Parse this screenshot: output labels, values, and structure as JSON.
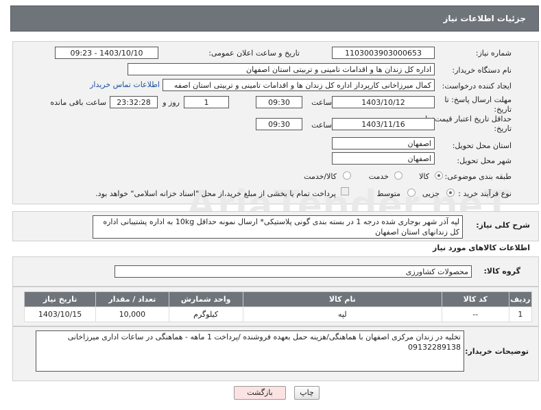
{
  "header": {
    "title": "جزئیات اطلاعات نیاز"
  },
  "form": {
    "need_number_label": "شماره نیاز:",
    "need_number": "1103003903000653",
    "announce_label": "تاریخ و ساعت اعلان عمومی:",
    "announce_value": "1403/10/10 - 09:23",
    "buyer_org_label": "نام دستگاه خریدار:",
    "buyer_org": "اداره کل زندان ها و اقدامات تامینی و تربیتی استان اصفهان",
    "creator_label": "ایجاد کننده درخواست:",
    "creator": "کمال میرزاخانی کارپرداز اداره کل زندان ها و اقدامات تامینی و تربیتی استان اصفه",
    "contact_link": "اطلاعات تماس خریدار",
    "deadline_label_1": "مهلت ارسال پاسخ: تا",
    "deadline_label_2": "تاریخ:",
    "deadline_date": "1403/10/12",
    "time_label": "ساعت",
    "deadline_time": "09:30",
    "days_value": "1",
    "days_label": "روز و",
    "remaining_time": "23:32:28",
    "remaining_label": "ساعت باقی مانده",
    "validity_label_1": "حداقل تاریخ اعتبار قیمت: تا",
    "validity_label_2": "تاریخ:",
    "validity_date": "1403/11/16",
    "validity_time": "09:30",
    "province_label": "استان محل تحویل:",
    "province": "اصفهان",
    "city_label": "شهر محل تحویل:",
    "city": "اصفهان",
    "category_label": "طبقه بندی موضوعی:",
    "category_options": [
      "کالا",
      "خدمت",
      "کالا/خدمت"
    ],
    "category_selected": "کالا",
    "process_label": "نوع فرآیند خرید :",
    "process_options": [
      "جزیی",
      "متوسط"
    ],
    "process_selected": "جزیی",
    "payment_note": "پرداخت تمام یا بخشی از مبلغ خرید،از محل \"اسناد خزانه اسلامی\" خواهد بود."
  },
  "watermark": {
    "text": "AriaTender.neT"
  },
  "description": {
    "label": "شرح کلی نیاز:",
    "text": "لپه آذر شهر بوجاری شده درجه 1  در بسته بندی گونی پلاستیکی* ارسال نمونه حداقل 10kg به اداره پشتیبانی اداره کل زندانهای استان اصفهان"
  },
  "goods": {
    "section_title": "اطلاعات کالاهای مورد نیاز",
    "group_label": "گروه کالا:",
    "group_value": "محصولات کشاورزی",
    "columns": [
      "ردیف",
      "کد کالا",
      "نام کالا",
      "واحد شمارش",
      "تعداد / مقدار",
      "تاریخ نیاز"
    ],
    "rows": [
      {
        "index": "1",
        "code": "--",
        "name": "لپه",
        "unit": "کیلوگرم",
        "qty": "10,000",
        "date": "1403/10/15"
      }
    ]
  },
  "buyer_notes": {
    "label": "توضیحات خریدار:",
    "text": "تخلیه در  زندان مرکزی اصفهان با هماهنگی/هزینه حمل بعهده فروشنده /پرداخت 1 ماهه - هماهنگی در ساعات اداری میرزاخانی 09132289138"
  },
  "buttons": {
    "print": "چاپ",
    "back": "بازگشت"
  },
  "colors": {
    "header_bg": "#6f747b",
    "link": "#1a4fa0",
    "back_button_bg": "#fbe3e3"
  }
}
